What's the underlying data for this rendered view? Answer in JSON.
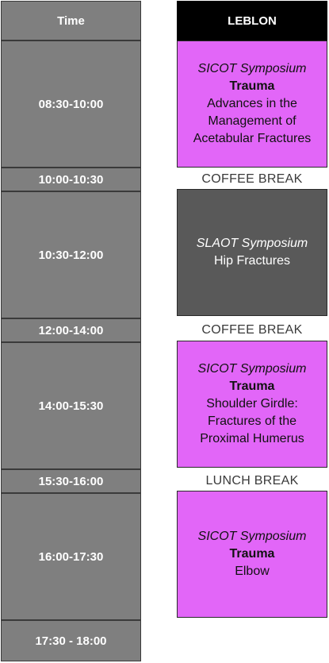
{
  "header": {
    "time_label": "Time",
    "venue_label": "LEBLON"
  },
  "times": [
    "08:30-10:00",
    "10:00-10:30",
    "10:30-12:00",
    "12:00-14:00",
    "14:00-15:30",
    "15:30-16:00",
    "16:00-17:30",
    "17:30 - 18:00"
  ],
  "sessions": [
    {
      "kind": "SICOT Symposium",
      "topic": "Trauma",
      "line1": "Advances in the",
      "line2": "Management of",
      "line3": "Acetabular Fractures"
    },
    {
      "kind": "SLAOT Symposium",
      "line1": "Hip Fractures"
    },
    {
      "kind": "SICOT Symposium",
      "topic": "Trauma",
      "line1": "Shoulder Girdle:",
      "line2": "Fractures of the",
      "line3": "Proximal Humerus"
    },
    {
      "kind": "SICOT Symposium",
      "topic": "Trauma",
      "line1": "Elbow"
    }
  ],
  "breaks": [
    "COFFEE BREAK",
    "COFFEE BREAK",
    "LUNCH BREAK"
  ],
  "colors": {
    "time_cell": "#7f7f7f",
    "header": "#000000",
    "sicot": "#e266f8",
    "slaot": "#595959"
  }
}
